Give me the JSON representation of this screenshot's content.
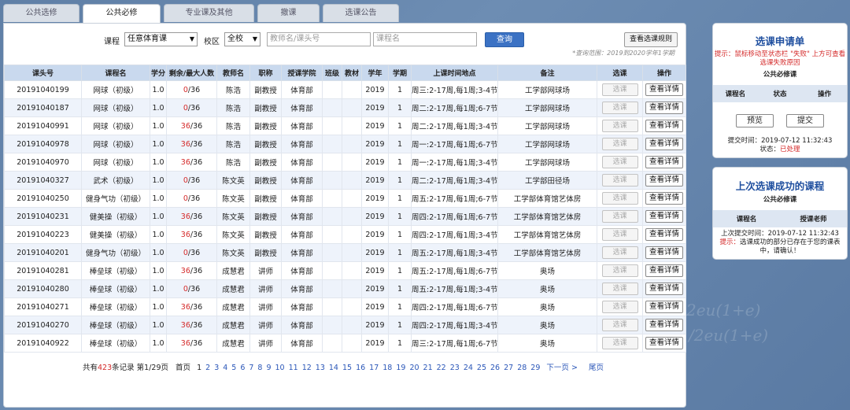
{
  "tabs": [
    {
      "label": "公共选修"
    },
    {
      "label": "公共必修",
      "active": true
    },
    {
      "label": "专业课及其他"
    },
    {
      "label": "撤课"
    },
    {
      "label": "选课公告"
    }
  ],
  "search": {
    "course_label": "课程",
    "course_value": "任意体育课",
    "campus_label": "校区",
    "campus_value": "全校",
    "teacher_placeholder": "教师名/课头号",
    "name_placeholder": "课程名",
    "query_button": "查询",
    "rules_button": "查看选课规则",
    "range_note": "*查询范围：2019到2020学年1学期"
  },
  "table": {
    "columns": [
      "课头号",
      "课程名",
      "学分",
      "剩余/最大人数",
      "教师名",
      "职称",
      "授课学院",
      "班级",
      "教材",
      "学年",
      "学期",
      "上课时间地点",
      "备注",
      "选课",
      "操作"
    ],
    "select_label": "选课",
    "detail_label": "查看详情",
    "rows": [
      {
        "id": "20191040199",
        "name": "网球（初级）",
        "credit": "1.0",
        "remain": "0",
        "max": "/36",
        "teacher": "陈浩",
        "title": "副教授",
        "college": "体育部",
        "year": "2019",
        "term": "1",
        "time": "周三:2-17周,每1周;3-4节;",
        "note": "工学部网球场"
      },
      {
        "id": "20191040187",
        "name": "网球（初级）",
        "credit": "1.0",
        "remain": "0",
        "max": "/36",
        "teacher": "陈浩",
        "title": "副教授",
        "college": "体育部",
        "year": "2019",
        "term": "1",
        "time": "周二:2-17周,每1周;6-7节;",
        "note": "工学部网球场"
      },
      {
        "id": "20191040991",
        "name": "网球（初级）",
        "credit": "1.0",
        "remain": "36",
        "max": "/36",
        "teacher": "陈浩",
        "title": "副教授",
        "college": "体育部",
        "year": "2019",
        "term": "1",
        "time": "周二:2-17周,每1周;3-4节;",
        "note": "工学部网球场"
      },
      {
        "id": "20191040978",
        "name": "网球（初级）",
        "credit": "1.0",
        "remain": "36",
        "max": "/36",
        "teacher": "陈浩",
        "title": "副教授",
        "college": "体育部",
        "year": "2019",
        "term": "1",
        "time": "周一:2-17周,每1周;6-7节;",
        "note": "工学部网球场"
      },
      {
        "id": "20191040970",
        "name": "网球（初级）",
        "credit": "1.0",
        "remain": "36",
        "max": "/36",
        "teacher": "陈浩",
        "title": "副教授",
        "college": "体育部",
        "year": "2019",
        "term": "1",
        "time": "周一:2-17周,每1周;3-4节;",
        "note": "工学部网球场"
      },
      {
        "id": "20191040327",
        "name": "武术（初级）",
        "credit": "1.0",
        "remain": "0",
        "max": "/36",
        "teacher": "陈文英",
        "title": "副教授",
        "college": "体育部",
        "year": "2019",
        "term": "1",
        "time": "周二:2-17周,每1周;3-4节;",
        "note": "工学部田径场"
      },
      {
        "id": "20191040250",
        "name": "健身气功（初级）",
        "credit": "1.0",
        "remain": "0",
        "max": "/36",
        "teacher": "陈文英",
        "title": "副教授",
        "college": "体育部",
        "year": "2019",
        "term": "1",
        "time": "周五:2-17周,每1周;6-7节;",
        "note": "工学部体育馆艺体房"
      },
      {
        "id": "20191040231",
        "name": "健美操（初级）",
        "credit": "1.0",
        "remain": "36",
        "max": "/36",
        "teacher": "陈文英",
        "title": "副教授",
        "college": "体育部",
        "year": "2019",
        "term": "1",
        "time": "周四:2-17周,每1周;6-7节;",
        "note": "工学部体育馆艺体房"
      },
      {
        "id": "20191040223",
        "name": "健美操（初级）",
        "credit": "1.0",
        "remain": "36",
        "max": "/36",
        "teacher": "陈文英",
        "title": "副教授",
        "college": "体育部",
        "year": "2019",
        "term": "1",
        "time": "周四:2-17周,每1周;3-4节;",
        "note": "工学部体育馆艺体房"
      },
      {
        "id": "20191040201",
        "name": "健身气功（初级）",
        "credit": "1.0",
        "remain": "0",
        "max": "/36",
        "teacher": "陈文英",
        "title": "副教授",
        "college": "体育部",
        "year": "2019",
        "term": "1",
        "time": "周五:2-17周,每1周;3-4节;",
        "note": "工学部体育馆艺体房"
      },
      {
        "id": "20191040281",
        "name": "棒垒球（初级）",
        "credit": "1.0",
        "remain": "36",
        "max": "/36",
        "teacher": "成慧君",
        "title": "讲师",
        "college": "体育部",
        "year": "2019",
        "term": "1",
        "time": "周五:2-17周,每1周;6-7节;",
        "note": "奥场"
      },
      {
        "id": "20191040280",
        "name": "棒垒球（初级）",
        "credit": "1.0",
        "remain": "0",
        "max": "/36",
        "teacher": "成慧君",
        "title": "讲师",
        "college": "体育部",
        "year": "2019",
        "term": "1",
        "time": "周五:2-17周,每1周;3-4节;",
        "note": "奥场"
      },
      {
        "id": "20191040271",
        "name": "棒垒球（初级）",
        "credit": "1.0",
        "remain": "36",
        "max": "/36",
        "teacher": "成慧君",
        "title": "讲师",
        "college": "体育部",
        "year": "2019",
        "term": "1",
        "time": "周四:2-17周,每1周;6-7节;",
        "note": "奥场"
      },
      {
        "id": "20191040270",
        "name": "棒垒球（初级）",
        "credit": "1.0",
        "remain": "36",
        "max": "/36",
        "teacher": "成慧君",
        "title": "讲师",
        "college": "体育部",
        "year": "2019",
        "term": "1",
        "time": "周四:2-17周,每1周;3-4节;",
        "note": "奥场"
      },
      {
        "id": "20191040922",
        "name": "棒垒球（初级）",
        "credit": "1.0",
        "remain": "36",
        "max": "/36",
        "teacher": "成慧君",
        "title": "讲师",
        "college": "体育部",
        "year": "2019",
        "term": "1",
        "time": "周三:2-17周,每1周;6-7节;",
        "note": "奥场"
      }
    ]
  },
  "pager": {
    "prefix": "共有",
    "count": "423",
    "suffix": "条记录 第1/29页",
    "first": "首页",
    "pages": [
      "1",
      "2",
      "3",
      "4",
      "5",
      "6",
      "7",
      "8",
      "9",
      "10",
      "11",
      "12",
      "13",
      "14",
      "15",
      "16",
      "17",
      "18",
      "19",
      "20",
      "21",
      "22",
      "23",
      "24",
      "25",
      "26",
      "27",
      "28",
      "29"
    ],
    "next": "下一页 >",
    "last": "尾页"
  },
  "apply_panel": {
    "title": "选课申请单",
    "hint": "提示：鼠标移动至状态栏 \"失败\" 上方可查看选课失败原因",
    "subtitle": "公共必修课",
    "headers": [
      "课程名",
      "状态",
      "操作"
    ],
    "preview_button": "预览",
    "submit_button": "提交",
    "submit_time": "提交时间：2019-07-12 11:32:43",
    "status_label": "状态：",
    "status_value": "已处理"
  },
  "success_panel": {
    "title": "上次选课成功的课程",
    "subtitle": "公共必修课",
    "headers": [
      "课程名",
      "授课老师"
    ],
    "last_time": "上次提交时间：2019-07-12 11:32:43",
    "tip_label": "提示：",
    "tip": "选课成功的部分已存在于您的课表中，请确认！"
  },
  "background": {
    "formula1": "2eu(1+e)",
    "formula2": "/2eu(1+e)"
  },
  "colors": {
    "accent": "#3b72c4",
    "header_bg": "#c9d9ee",
    "warn": "#d42a2a",
    "panel_title": "#1f4f9f"
  }
}
